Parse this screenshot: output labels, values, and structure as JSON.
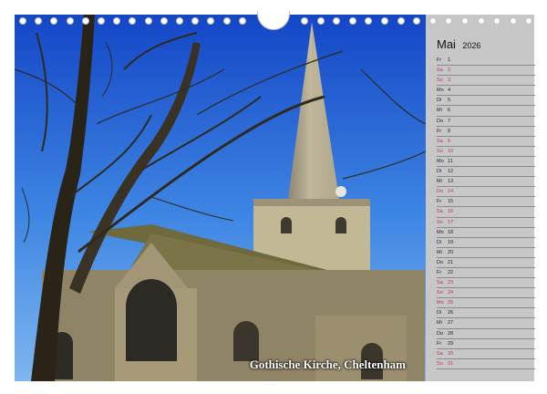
{
  "calendar": {
    "month": "Mai",
    "year": "2026",
    "caption": "Gothische Kirche, Cheltenham",
    "weekend_color": "#c0306e",
    "text_color": "#222222",
    "days": [
      {
        "wd": "Fr",
        "d": "1",
        "we": false
      },
      {
        "wd": "Sa",
        "d": "2",
        "we": true
      },
      {
        "wd": "So",
        "d": "3",
        "we": true
      },
      {
        "wd": "Mo",
        "d": "4",
        "we": false
      },
      {
        "wd": "Di",
        "d": "5",
        "we": false
      },
      {
        "wd": "Mi",
        "d": "6",
        "we": false
      },
      {
        "wd": "Do",
        "d": "7",
        "we": false
      },
      {
        "wd": "Fr",
        "d": "8",
        "we": false
      },
      {
        "wd": "Sa",
        "d": "9",
        "we": true
      },
      {
        "wd": "So",
        "d": "10",
        "we": true
      },
      {
        "wd": "Mo",
        "d": "11",
        "we": false
      },
      {
        "wd": "Di",
        "d": "12",
        "we": false
      },
      {
        "wd": "Mi",
        "d": "13",
        "we": false
      },
      {
        "wd": "Do",
        "d": "14",
        "we": true
      },
      {
        "wd": "Fr",
        "d": "15",
        "we": false
      },
      {
        "wd": "Sa",
        "d": "16",
        "we": true
      },
      {
        "wd": "So",
        "d": "17",
        "we": true
      },
      {
        "wd": "Mo",
        "d": "18",
        "we": false
      },
      {
        "wd": "Di",
        "d": "19",
        "we": false
      },
      {
        "wd": "Mi",
        "d": "20",
        "we": false
      },
      {
        "wd": "Do",
        "d": "21",
        "we": false
      },
      {
        "wd": "Fr",
        "d": "22",
        "we": false
      },
      {
        "wd": "Sa",
        "d": "23",
        "we": true
      },
      {
        "wd": "So",
        "d": "24",
        "we": true
      },
      {
        "wd": "Mo",
        "d": "25",
        "we": true
      },
      {
        "wd": "Di",
        "d": "26",
        "we": false
      },
      {
        "wd": "Mi",
        "d": "27",
        "we": false
      },
      {
        "wd": "Do",
        "d": "28",
        "we": false
      },
      {
        "wd": "Fr",
        "d": "29",
        "we": false
      },
      {
        "wd": "Sa",
        "d": "30",
        "we": true
      },
      {
        "wd": "So",
        "d": "31",
        "we": true
      }
    ]
  }
}
